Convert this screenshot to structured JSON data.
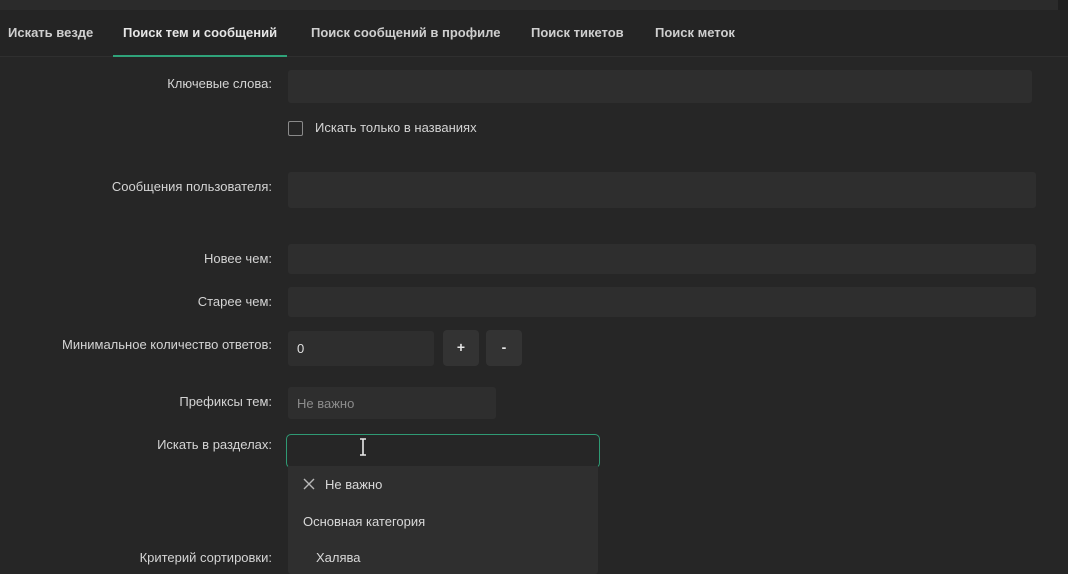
{
  "tabs": [
    {
      "label": "Искать везде"
    },
    {
      "label": "Поиск тем и сообщений"
    },
    {
      "label": "Поиск сообщений в профиле"
    },
    {
      "label": "Поиск тикетов"
    },
    {
      "label": "Поиск меток"
    }
  ],
  "active_tab": "Поиск тем и сообщений",
  "form": {
    "keywords_label": "Ключевые слова:",
    "keywords_value": "",
    "titles_only_label": "Искать только в названиях",
    "titles_only_checked": false,
    "user_posts_label": "Сообщения пользователя:",
    "user_posts_value": "",
    "newer_than_label": "Новее чем:",
    "older_than_label": "Старее чем:",
    "min_replies_label": "Минимальное количество ответов:",
    "min_replies_value": "0",
    "plus_label": "+",
    "minus_label": "-",
    "prefixes_label": "Префиксы тем:",
    "prefixes_placeholder": "Не важно",
    "sections_label": "Искать в разделах:",
    "sort_label": "Критерий сортировки:"
  },
  "dropdown": {
    "items": [
      {
        "label": "Не важно",
        "icon": "close-icon"
      },
      {
        "label": "Основная категория"
      },
      {
        "label": "Халява"
      }
    ]
  },
  "colors": {
    "accent": "#2fa37a",
    "background": "#262626",
    "field": "#2e2e2e"
  }
}
